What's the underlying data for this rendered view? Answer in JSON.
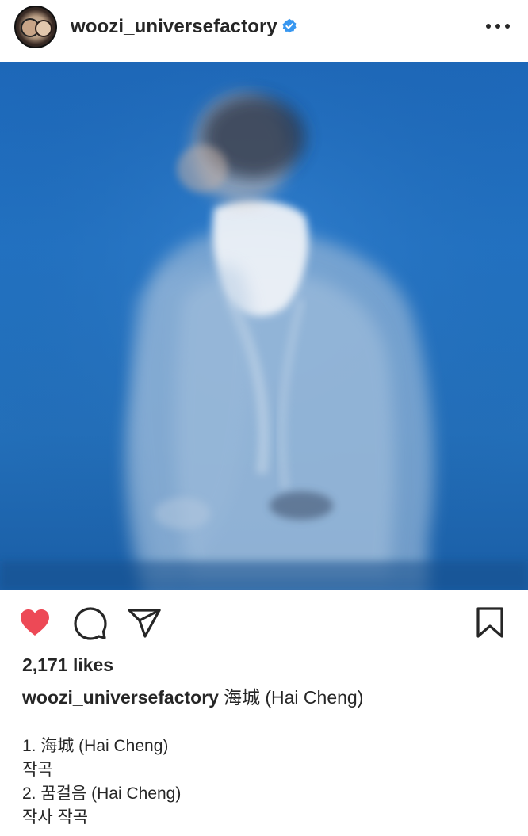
{
  "post": {
    "username": "woozi_universefactory",
    "verified_icon": "verified-badge-icon",
    "more_icon": "more-options-icon",
    "likes": "2,171 likes",
    "caption_user": "woozi_universefactory",
    "caption_text": "海城 (Hai Cheng)",
    "caption_lines": [
      "1. 海城 (Hai Cheng)",
      "작곡",
      "2. 꿈걸음 (Hai Cheng)",
      "작사 작곡"
    ],
    "liked": true
  },
  "actions": {
    "like_icon": "heart-filled-icon",
    "comment_icon": "comment-icon",
    "share_icon": "share-icon",
    "save_icon": "bookmark-icon"
  },
  "colors": {
    "heart": "#ed4956",
    "photo_bg": "#1f6cb9",
    "verified": "#3897f0"
  }
}
